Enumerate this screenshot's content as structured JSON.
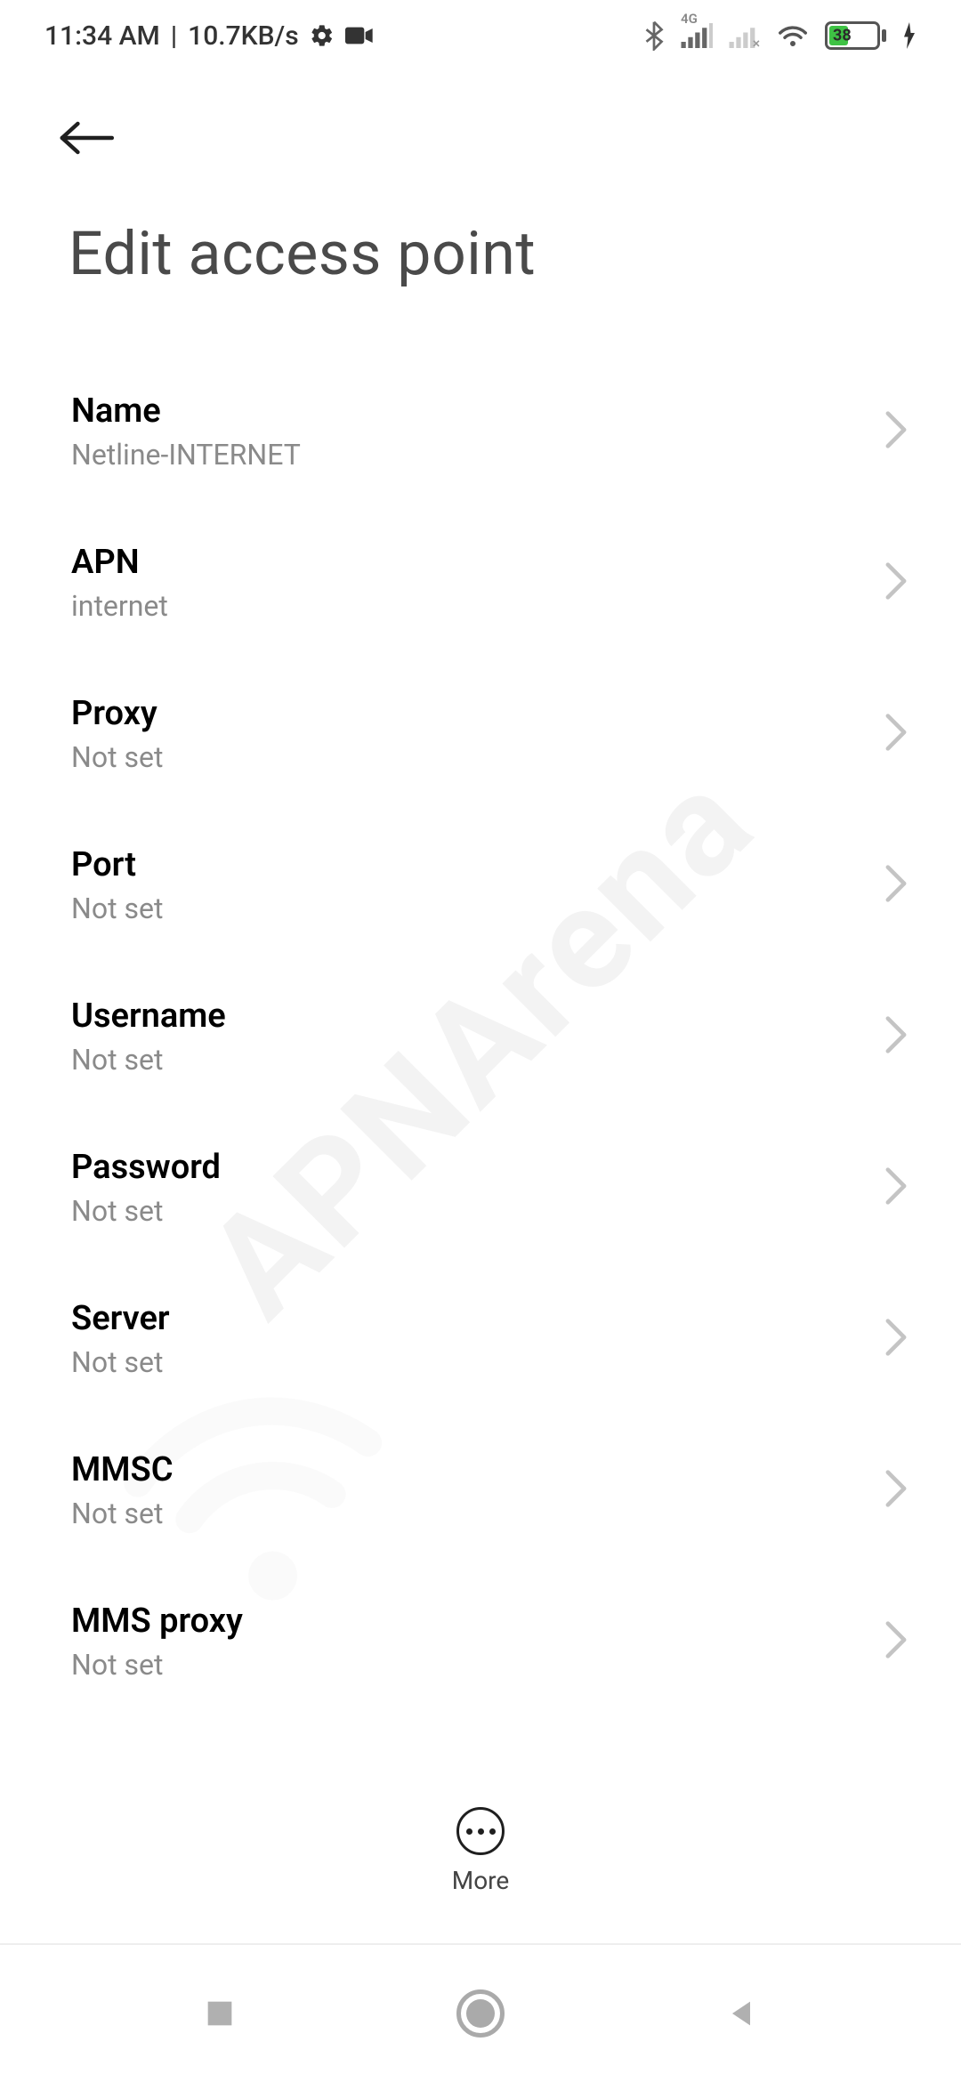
{
  "status_bar": {
    "time": "11:34 AM",
    "speed": "10.7KB/s",
    "network_badge": "4G",
    "battery_percent": "38"
  },
  "header": {
    "title": "Edit access point"
  },
  "settings": [
    {
      "label": "Name",
      "value": "Netline-INTERNET"
    },
    {
      "label": "APN",
      "value": "internet"
    },
    {
      "label": "Proxy",
      "value": "Not set"
    },
    {
      "label": "Port",
      "value": "Not set"
    },
    {
      "label": "Username",
      "value": "Not set"
    },
    {
      "label": "Password",
      "value": "Not set"
    },
    {
      "label": "Server",
      "value": "Not set"
    },
    {
      "label": "MMSC",
      "value": "Not set"
    },
    {
      "label": "MMS proxy",
      "value": "Not set"
    }
  ],
  "bottom": {
    "more_label": "More"
  },
  "watermark": {
    "text": "APNArena"
  }
}
